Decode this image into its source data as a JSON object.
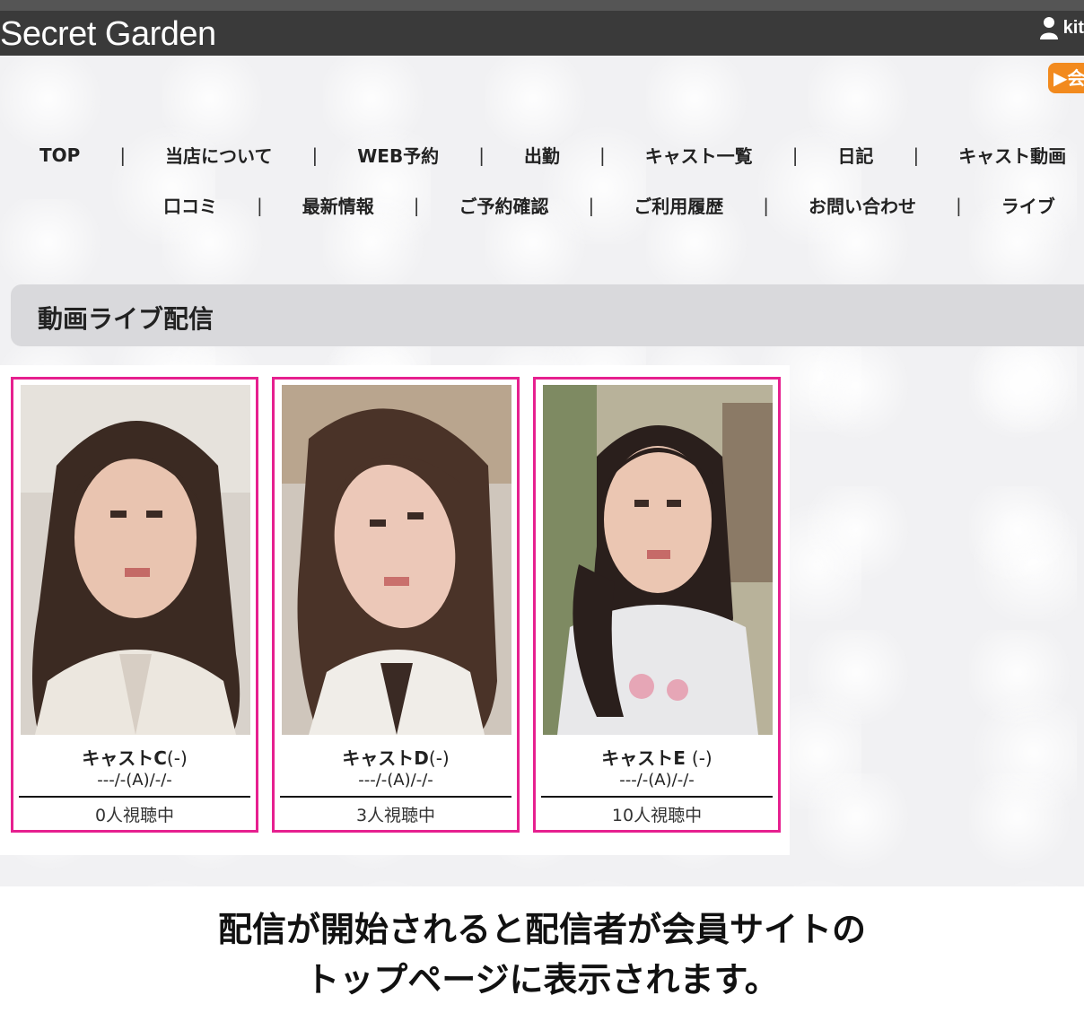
{
  "header": {
    "brand": "Secret Garden",
    "user_label": "kit"
  },
  "live_button": {
    "label": "▶会"
  },
  "nav": {
    "row1": [
      "TOP",
      "当店について",
      "WEB予約",
      "出勤",
      "キャスト一覧",
      "日記",
      "キャスト動画"
    ],
    "row2": [
      "口コミ",
      "最新情報",
      "ご予約確認",
      "ご利用履歴",
      "お問い合わせ",
      "ライブ"
    ]
  },
  "section": {
    "title": "動画ライブ配信"
  },
  "cards": [
    {
      "name": "キャストC",
      "suffix": "(-)",
      "date": "---/-(A)/-/-",
      "viewers": "0人視聴中"
    },
    {
      "name": "キャストD",
      "suffix": "(-)",
      "date": "---/-(A)/-/-",
      "viewers": "3人視聴中"
    },
    {
      "name": "キャストE",
      "suffix": "(-)",
      "date": "---/-(A)/-/-",
      "viewers": "10人視聴中"
    }
  ],
  "caption": {
    "line1": "配信が開始されると配信者が会員サイトの",
    "line2": "トップページに表示されます。"
  },
  "colors": {
    "topbar": "#3a3a3a",
    "card_border": "#e6208f",
    "live_button": "#f28a1e"
  }
}
